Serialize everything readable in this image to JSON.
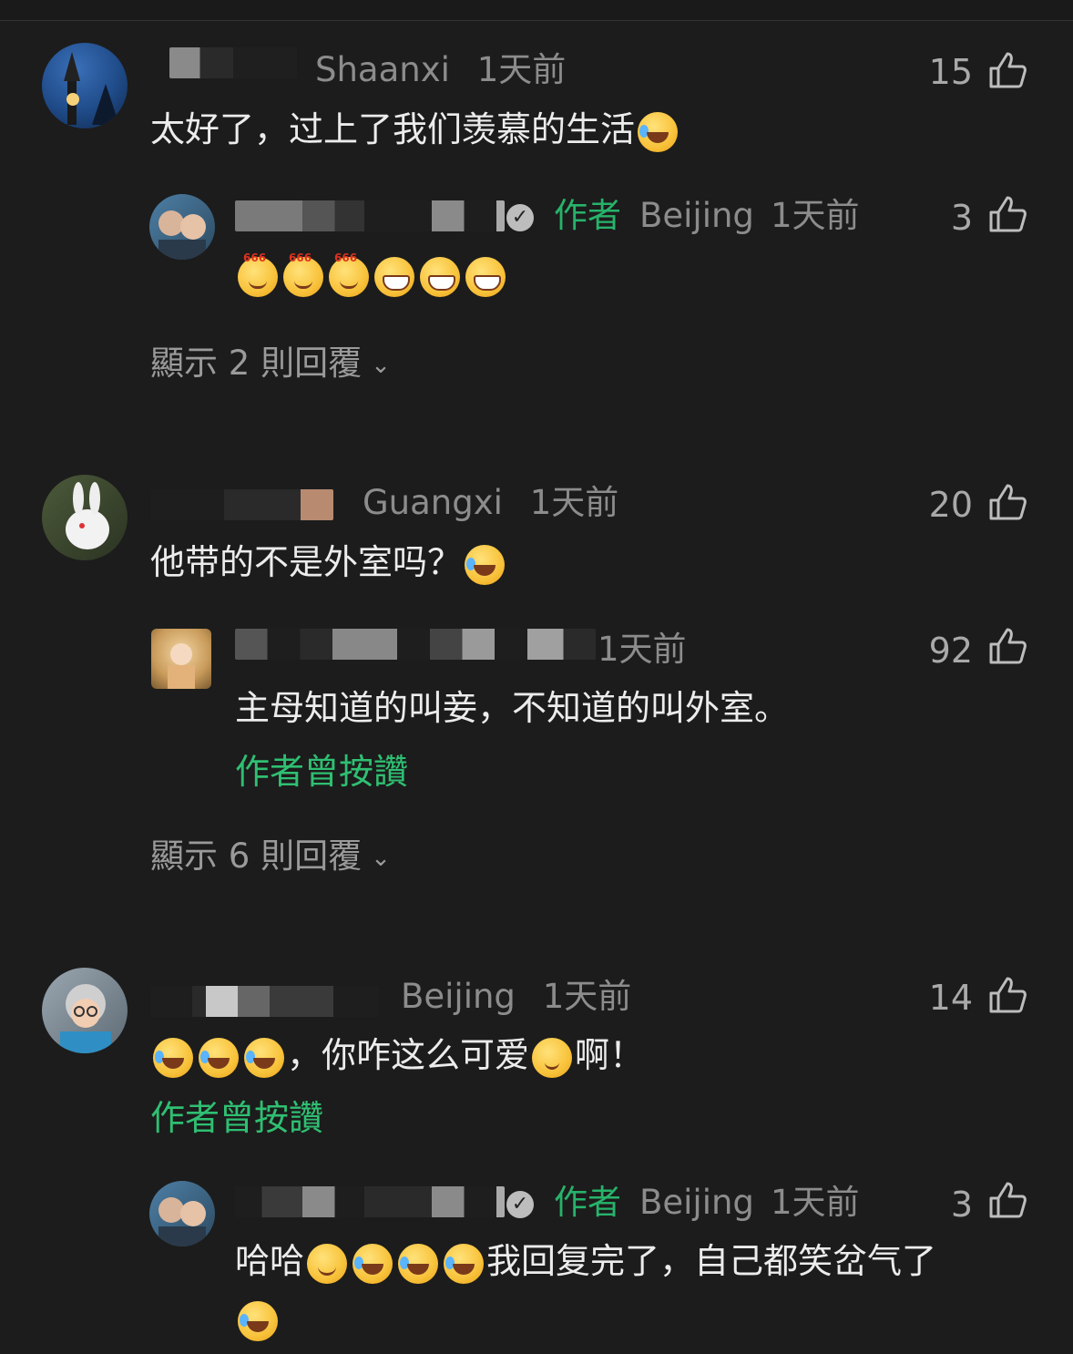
{
  "comments": [
    {
      "location": "Shaanxi",
      "time": "1天前",
      "likes": "15",
      "text": "太好了，过上了我们羡慕的生活",
      "reply": {
        "author_tag": "作者",
        "location": "Beijing",
        "time": "1天前",
        "likes": "3",
        "emojis": [
          "six",
          "six",
          "six",
          "grin",
          "grin",
          "grin"
        ]
      },
      "show_replies": "顯示 2 則回覆"
    },
    {
      "location": "Guangxi",
      "time": "1天前",
      "likes": "20",
      "text": "他带的不是外室吗？",
      "reply": {
        "time": "1天前",
        "likes": "92",
        "text": "主母知道的叫妾，不知道的叫外室。",
        "liked_badge": "作者曾按讚"
      },
      "show_replies": "顯示 6 則回覆"
    },
    {
      "location": "Beijing",
      "time": "1天前",
      "likes": "14",
      "text_a": "，你咋这么可爱",
      "text_b": "啊！",
      "liked_badge": "作者曾按讚",
      "reply": {
        "author_tag": "作者",
        "location": "Beijing",
        "time": "1天前",
        "likes": "3",
        "text_a": "哈哈",
        "text_b": "我回复完了，自己都笑岔气了"
      }
    }
  ],
  "colors": {
    "background": "#1c1c1c",
    "text": "#ececec",
    "meta": "#8c8c8c",
    "accent_green": "#27b36a"
  }
}
